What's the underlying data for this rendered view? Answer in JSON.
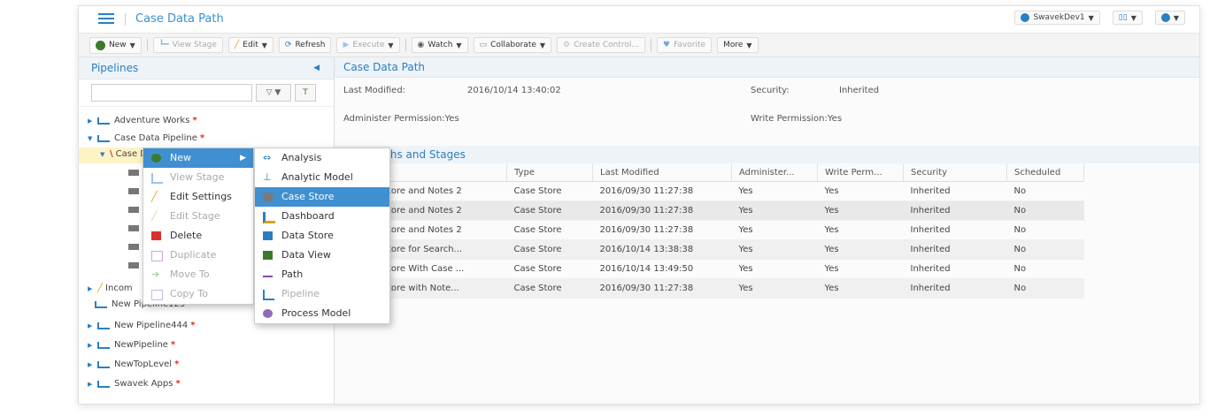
{
  "app": {
    "title": "Case Data Path",
    "user": "SwavekDev1"
  },
  "toolbar": {
    "new": "New",
    "view_stage": "View Stage",
    "edit": "Edit",
    "refresh": "Refresh",
    "execute": "Execute",
    "watch": "Watch",
    "collaborate": "Collaborate",
    "create_control": "Create Control...",
    "favorite": "Favorite",
    "more": "More"
  },
  "left": {
    "header": "Pipelines",
    "tree": [
      {
        "label": "Adventure Works",
        "star": "*"
      },
      {
        "label": "Case Data Pipeline",
        "star": "*"
      },
      {
        "label": "Case Data Path"
      },
      {
        "label": "Incom"
      },
      {
        "label": "New Pipeline123",
        "star": "*"
      },
      {
        "label": "New Pipeline444",
        "star": "*"
      },
      {
        "label": "NewPipeline",
        "star": "*"
      },
      {
        "label": "NewTopLevel",
        "star": "*"
      },
      {
        "label": "Swavek Apps",
        "star": "*"
      }
    ]
  },
  "right": {
    "title": "Case Data Path",
    "last_modified_label": "Last Modified:",
    "last_modified_value": "2016/10/14 13:40:02",
    "security_label": "Security:",
    "security_value": "Inherited",
    "admin_perm": "Administer Permission:Yes",
    "write_perm": "Write Permission:Yes",
    "section": "Child Paths and Stages",
    "columns": [
      "Name",
      "Type",
      "Last Modified",
      "Administer...",
      "Write Perm...",
      "Security",
      "Scheduled"
    ],
    "rows": [
      [
        "Case Store and Notes 2",
        "Case Store",
        "2016/09/30 11:27:38",
        "Yes",
        "Yes",
        "Inherited",
        "No"
      ],
      [
        "Case Store and Notes 2",
        "Case Store",
        "2016/09/30 11:27:38",
        "Yes",
        "Yes",
        "Inherited",
        "No"
      ],
      [
        "Case Store and Notes 2",
        "Case Store",
        "2016/09/30 11:27:38",
        "Yes",
        "Yes",
        "Inherited",
        "No"
      ],
      [
        "Case Store for Search...",
        "Case Store",
        "2016/10/14 13:38:38",
        "Yes",
        "Yes",
        "Inherited",
        "No"
      ],
      [
        "Case Store With Case ...",
        "Case Store",
        "2016/10/14 13:49:50",
        "Yes",
        "Yes",
        "Inherited",
        "No"
      ],
      [
        "Case Store with Note...",
        "Case Store",
        "2016/09/30 11:27:38",
        "Yes",
        "Yes",
        "Inherited",
        "No"
      ]
    ]
  },
  "context_menu": {
    "items": [
      {
        "label": "New",
        "disabled": false
      },
      {
        "label": "View Stage",
        "disabled": true
      },
      {
        "label": "Edit Settings",
        "disabled": false
      },
      {
        "label": "Edit Stage",
        "disabled": true
      },
      {
        "label": "Delete",
        "disabled": false
      },
      {
        "label": "Duplicate",
        "disabled": true
      },
      {
        "label": "Move To",
        "disabled": true
      },
      {
        "label": "Copy To",
        "disabled": true
      }
    ]
  },
  "submenu": {
    "items": [
      {
        "label": "Analysis",
        "disabled": false
      },
      {
        "label": "Analytic Model",
        "disabled": false
      },
      {
        "label": "Case Store",
        "disabled": false
      },
      {
        "label": "Dashboard",
        "disabled": false
      },
      {
        "label": "Data Store",
        "disabled": false
      },
      {
        "label": "Data View",
        "disabled": false
      },
      {
        "label": "Path",
        "disabled": false
      },
      {
        "label": "Pipeline",
        "disabled": true
      },
      {
        "label": "Process Model",
        "disabled": false
      }
    ]
  }
}
